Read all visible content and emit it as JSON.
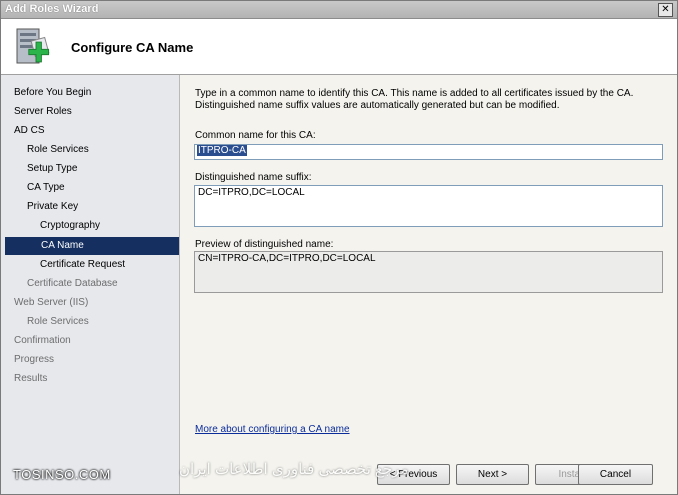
{
  "window": {
    "title": "Add Roles Wizard",
    "close_glyph": "✕"
  },
  "header": {
    "heading": "Configure CA Name",
    "icon": "server-add-icon"
  },
  "sidebar": {
    "items": [
      {
        "label": "Before You Begin",
        "state": "normal"
      },
      {
        "label": "Server Roles",
        "state": "normal"
      },
      {
        "label": "AD CS",
        "state": "normal"
      },
      {
        "label": "Role Services",
        "state": "normal"
      },
      {
        "label": "Setup Type",
        "state": "normal"
      },
      {
        "label": "CA Type",
        "state": "normal"
      },
      {
        "label": "Private Key",
        "state": "normal"
      },
      {
        "label": "Cryptography",
        "state": "normal"
      },
      {
        "label": "CA Name",
        "state": "selected"
      },
      {
        "label": "Certificate Request",
        "state": "normal"
      },
      {
        "label": "Certificate Database",
        "state": "disabled"
      },
      {
        "label": "Web Server (IIS)",
        "state": "disabled"
      },
      {
        "label": "Role Services",
        "state": "disabled"
      },
      {
        "label": "Confirmation",
        "state": "disabled"
      },
      {
        "label": "Progress",
        "state": "disabled"
      },
      {
        "label": "Results",
        "state": "disabled"
      }
    ]
  },
  "main": {
    "description": "Type in a common name to identify this CA. This name is added to all certificates issued by the CA. Distinguished name suffix values are automatically generated but can be modified.",
    "common_name_label": "Common name for this CA:",
    "common_name_value": "ITPRO-CA",
    "suffix_label": "Distinguished name suffix:",
    "suffix_value": "DC=ITPRO,DC=LOCAL",
    "preview_label": "Preview of distinguished name:",
    "preview_value": "CN=ITPRO-CA,DC=ITPRO,DC=LOCAL",
    "help_link": "More about configuring a CA name"
  },
  "buttons": {
    "previous": "< Previous",
    "next": "Next >",
    "install": "Install",
    "cancel": "Cancel"
  },
  "watermark": {
    "left": "TOSINSO.COM",
    "right": "مرجع تخصصی فناوری اطلاعات ایران"
  },
  "colors": {
    "selection": "#142f60",
    "link": "#0b2d9c",
    "sidebar_bg": "#e6e8ec",
    "content_bg": "#f4f3ee"
  }
}
